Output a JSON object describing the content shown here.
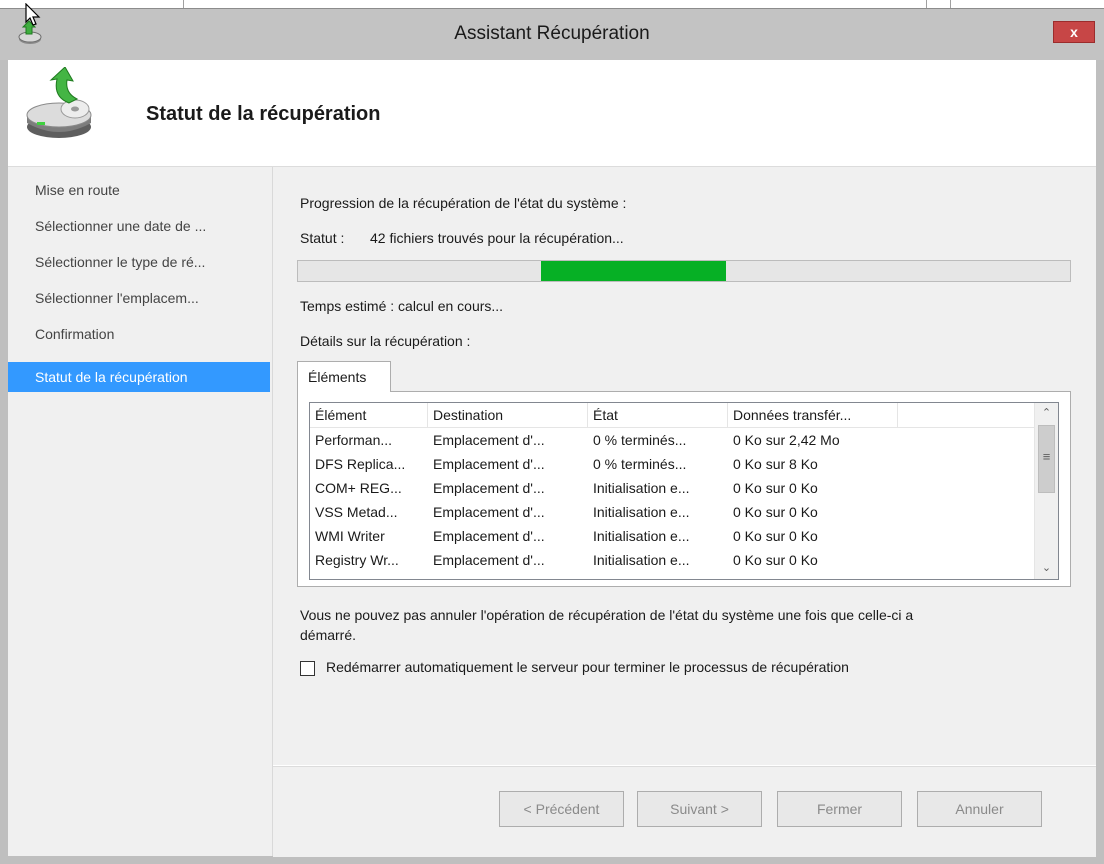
{
  "window": {
    "title": "Assistant Récupération",
    "close_label": "x"
  },
  "header": {
    "title": "Statut de la récupération"
  },
  "sidebar": {
    "items": [
      {
        "label": "Mise en route"
      },
      {
        "label": "Sélectionner une date de ..."
      },
      {
        "label": "Sélectionner le type de ré..."
      },
      {
        "label": "Sélectionner l'emplacem..."
      },
      {
        "label": "Confirmation"
      },
      {
        "label": "Statut de la récupération"
      }
    ],
    "active_index": 5
  },
  "main": {
    "progress_heading": "Progression de la récupération de l'état du système :",
    "status_label": "Statut :",
    "status_value": "42 fichiers trouvés pour la récupération...",
    "progress_segment": {
      "start": 0.315,
      "end": 0.555
    },
    "progress_color": "#06b025",
    "estimated_time": "Temps estimé : calcul en cours...",
    "details_heading": "Détails sur la récupération :",
    "tab_label": "Éléments",
    "table": {
      "columns": [
        "Élément",
        "Destination",
        "État",
        "Données transfér..."
      ],
      "rows": [
        [
          "Performan...",
          "Emplacement d'...",
          "0 % terminés...",
          "0 Ko sur 2,42 Mo"
        ],
        [
          "DFS Replica...",
          "Emplacement d'...",
          "0 % terminés...",
          "0 Ko sur 8 Ko"
        ],
        [
          "COM+ REG...",
          "Emplacement d'...",
          "Initialisation e...",
          "0 Ko sur 0 Ko"
        ],
        [
          "VSS Metad...",
          "Emplacement d'...",
          "Initialisation e...",
          "0 Ko sur 0 Ko"
        ],
        [
          "WMI Writer",
          "Emplacement d'...",
          "Initialisation e...",
          "0 Ko sur 0 Ko"
        ],
        [
          "Registry Wr...",
          "Emplacement d'...",
          "Initialisation e...",
          "0 Ko sur 0 Ko"
        ]
      ]
    },
    "warning_line1": "Vous ne pouvez pas annuler l'opération de récupération de l'état du système une fois que celle-ci a",
    "warning_line2": "démarré.",
    "restart_checkbox_label": "Redémarrer automatiquement le serveur pour terminer le processus de récupération",
    "restart_checked": false
  },
  "footer": {
    "previous_label": "< Précédent",
    "next_label": "Suivant >",
    "close_label": "Fermer",
    "cancel_label": "Annuler"
  }
}
